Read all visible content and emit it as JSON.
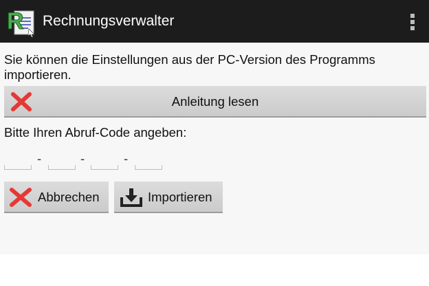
{
  "app": {
    "title": "Rechnungsverwalter",
    "logo_icon": "app-logo-r-icon",
    "menu_icon": "overflow-menu-icon"
  },
  "colors": {
    "actionbar": "#1c1c1c",
    "background": "#f7f7f7",
    "button": "#d4d4d4",
    "cancel_x": "#e53935",
    "logo_green": "#4caf50"
  },
  "main": {
    "intro_text": "Sie können die Einstellungen aus der PC-Version des Programms importieren.",
    "guide_button_label": "Anleitung lesen",
    "guide_button_icon": "close-x-icon",
    "code_label": "Bitte Ihren Abruf-Code angeben:",
    "code_fields": [
      {
        "value": "",
        "placeholder": ""
      },
      {
        "value": "",
        "placeholder": ""
      },
      {
        "value": "",
        "placeholder": ""
      },
      {
        "value": "",
        "placeholder": ""
      }
    ],
    "code_separator": "-"
  },
  "actions": {
    "cancel_label": "Abbrechen",
    "cancel_icon": "close-x-icon",
    "import_label": "Importieren",
    "import_icon": "download-icon"
  }
}
